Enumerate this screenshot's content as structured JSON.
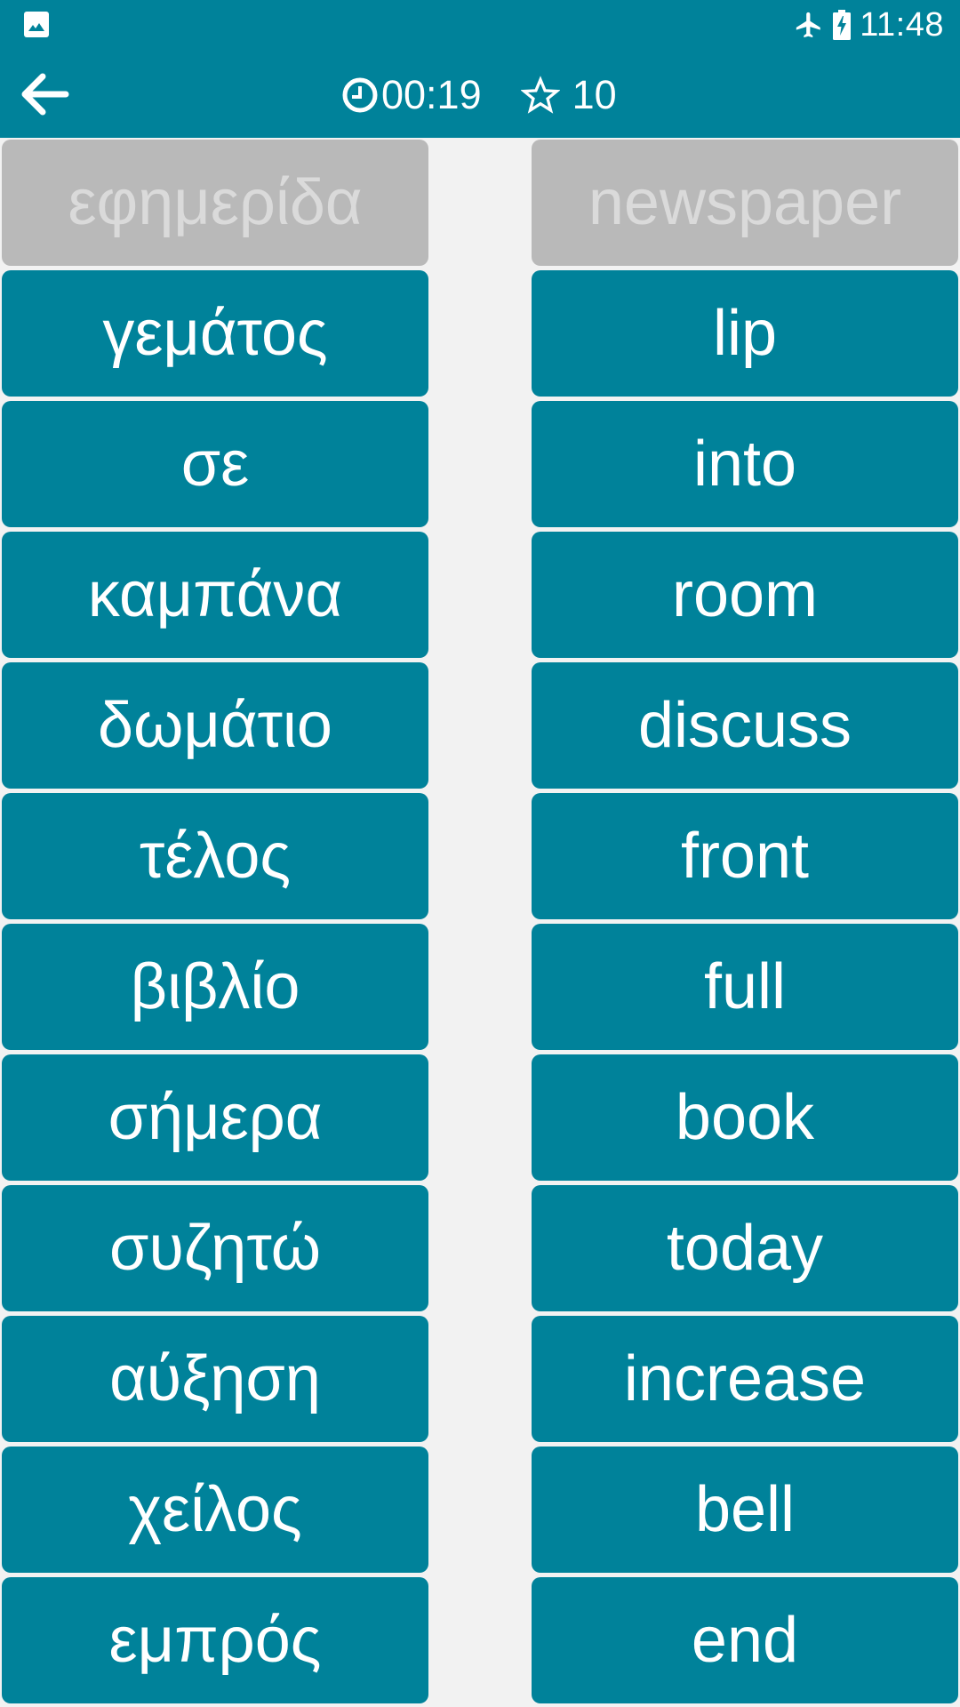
{
  "status_bar": {
    "notification_icon": "image-icon",
    "airplane_icon": "airplane-mode-icon",
    "battery_icon": "battery-charging-icon",
    "time": "11:48"
  },
  "toolbar": {
    "back_icon": "arrow-left-icon",
    "timer_icon": "clock-icon",
    "timer": "00:19",
    "score_icon": "star-outline-icon",
    "score": "10"
  },
  "colors": {
    "primary": "#00829A",
    "matched_card": "#B9B9B9",
    "matched_text": "#DADADA",
    "background": "#F2F2F2",
    "text": "#FFFFFF"
  },
  "left_words": [
    {
      "text": "εφημερίδα",
      "state": "matched"
    },
    {
      "text": "γεμάτος",
      "state": "active"
    },
    {
      "text": "σε",
      "state": "active"
    },
    {
      "text": "καμπάνα",
      "state": "active"
    },
    {
      "text": "δωμάτιο",
      "state": "active"
    },
    {
      "text": "τέλος",
      "state": "active"
    },
    {
      "text": "βιβλίο",
      "state": "active"
    },
    {
      "text": "σήμερα",
      "state": "active"
    },
    {
      "text": "συζητώ",
      "state": "active"
    },
    {
      "text": "αύξηση",
      "state": "active"
    },
    {
      "text": "χείλος",
      "state": "active"
    },
    {
      "text": "εμπρός",
      "state": "active"
    }
  ],
  "right_words": [
    {
      "text": "newspaper",
      "state": "matched"
    },
    {
      "text": "lip",
      "state": "active"
    },
    {
      "text": "into",
      "state": "active"
    },
    {
      "text": "room",
      "state": "active"
    },
    {
      "text": "discuss",
      "state": "active"
    },
    {
      "text": "front",
      "state": "active"
    },
    {
      "text": "full",
      "state": "active"
    },
    {
      "text": "book",
      "state": "active"
    },
    {
      "text": "today",
      "state": "active"
    },
    {
      "text": "increase",
      "state": "active"
    },
    {
      "text": "bell",
      "state": "active"
    },
    {
      "text": "end",
      "state": "active"
    }
  ]
}
